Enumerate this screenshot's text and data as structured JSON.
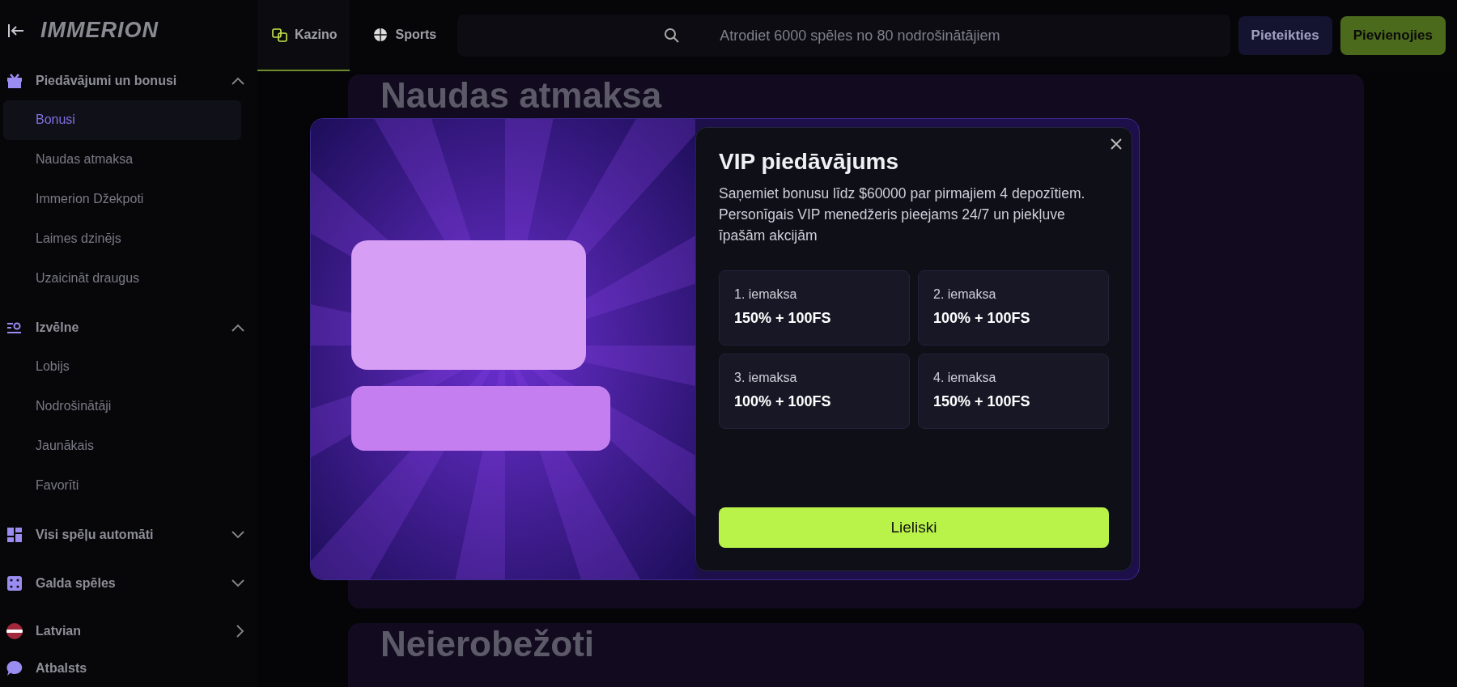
{
  "sidebar": {
    "logo": "IMMERION",
    "sections": [
      {
        "title": "Piedāvājumi un bonusi",
        "expanded": true,
        "items": [
          {
            "label": "Bonusi",
            "selected": true
          },
          {
            "label": "Naudas atmaksa",
            "selected": false
          },
          {
            "label": "Immerion Džekpoti",
            "selected": false
          },
          {
            "label": "Laimes dzinējs",
            "selected": false
          },
          {
            "label": "Uzaicināt draugus",
            "selected": false
          }
        ]
      },
      {
        "title": "Izvēlne",
        "expanded": true,
        "items": [
          {
            "label": "Lobijs",
            "selected": false
          },
          {
            "label": "Nodrošinātāji",
            "selected": false
          },
          {
            "label": "Jaunākais",
            "selected": false
          },
          {
            "label": "Favorīti",
            "selected": false
          }
        ]
      },
      {
        "title": "Visi spēļu automāti",
        "expanded": false
      },
      {
        "title": "Galda spēles",
        "expanded": false
      }
    ],
    "language": "Latvian",
    "support": "Atbalsts"
  },
  "topbar": {
    "tabs": [
      {
        "label": "Kazino",
        "selected": true
      },
      {
        "label": "Sports",
        "selected": false
      }
    ],
    "search": {
      "placeholder": "Atrodiet 6000 spēles no 80 nodrošinātājiem"
    },
    "login": "Pieteikties",
    "join": "Pievienojies"
  },
  "background": {
    "headings": [
      "Naudas atmaksa",
      "Neierobežoti"
    ]
  },
  "modal": {
    "title": "VIP piedāvājums",
    "text": "Saņemiet bonusu līdz $60000 par pirmajiem 4 depozītiem. Personīgais VIP menedžeris pieejams 24/7 un piekļuve īpašām akcijām",
    "deposits": [
      {
        "label": "1. iemaksa",
        "value": "150% + 100FS"
      },
      {
        "label": "2. iemaksa",
        "value": "100% + 100FS"
      },
      {
        "label": "3. iemaksa",
        "value": "100% + 100FS"
      },
      {
        "label": "4. iemaksa",
        "value": "150% + 100FS"
      }
    ],
    "button": "Lieliski"
  }
}
